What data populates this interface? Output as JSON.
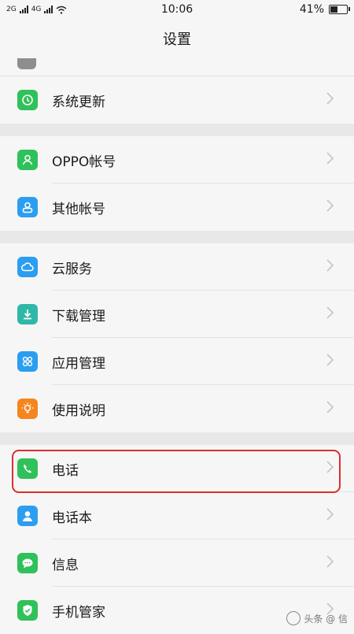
{
  "status_bar": {
    "signal_1": "2G",
    "signal_2": "4G",
    "time": "10:06",
    "battery_text": "41%",
    "battery_level": 0.41
  },
  "header": {
    "title": "设置"
  },
  "groups": [
    {
      "items": [
        {
          "label": "系统更新",
          "icon": "system-update-icon",
          "color": "#2fc15a"
        }
      ]
    },
    {
      "items": [
        {
          "label": "OPPO帐号",
          "icon": "account-icon",
          "color": "#2fc15a"
        },
        {
          "label": "其他帐号",
          "icon": "other-account-icon",
          "color": "#2c9ef0"
        }
      ]
    },
    {
      "items": [
        {
          "label": "云服务",
          "icon": "cloud-icon",
          "color": "#2c9ef0"
        },
        {
          "label": "下载管理",
          "icon": "download-icon",
          "color": "#2fb8a8"
        },
        {
          "label": "应用管理",
          "icon": "apps-icon",
          "color": "#2c9ef0"
        },
        {
          "label": "使用说明",
          "icon": "lightbulb-icon",
          "color": "#f5861f"
        }
      ]
    },
    {
      "items": [
        {
          "label": "电话",
          "icon": "phone-icon",
          "color": "#2fc15a"
        },
        {
          "label": "电话本",
          "icon": "contacts-icon",
          "color": "#2c9ef0"
        },
        {
          "label": "信息",
          "icon": "message-icon",
          "color": "#2fc15a"
        },
        {
          "label": "手机管家",
          "icon": "shield-icon",
          "color": "#2fc15a"
        }
      ]
    }
  ],
  "watermark": {
    "text": "头条 @ 信"
  }
}
